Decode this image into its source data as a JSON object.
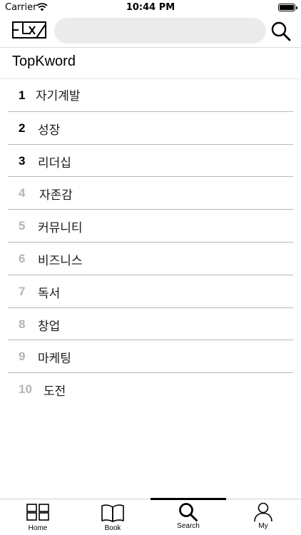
{
  "status_bar": {
    "carrier": "Carrier",
    "time": "10:44 PM",
    "icons": [
      "wifi-icon",
      "battery-icon"
    ]
  },
  "header": {
    "logo_icon": "brand-logo-icon",
    "search_placeholder": "",
    "search_icon": "search-icon"
  },
  "section": {
    "title": "TopKword"
  },
  "rankings": [
    {
      "rank": "1",
      "word": "자기계발"
    },
    {
      "rank": "2",
      "word": "성장"
    },
    {
      "rank": "3",
      "word": "리더십"
    },
    {
      "rank": "4",
      "word": "자존감"
    },
    {
      "rank": "5",
      "word": "커뮤니티"
    },
    {
      "rank": "6",
      "word": "비즈니스"
    },
    {
      "rank": "7",
      "word": "독서"
    },
    {
      "rank": "8",
      "word": "창업"
    },
    {
      "rank": "9",
      "word": "마케팅"
    },
    {
      "rank": "10",
      "word": "도전"
    }
  ],
  "colors": {
    "top_rank": "#000000",
    "other_rank": "#b5b5b5",
    "search_background": "#ebebeb"
  },
  "tab_bar": {
    "active_tab": "Search",
    "tabs": [
      {
        "label": "Home",
        "icon": "grid-icon"
      },
      {
        "label": "Book",
        "icon": "book-icon"
      },
      {
        "label": "Search",
        "icon": "search-icon"
      },
      {
        "label": "My",
        "icon": "user-icon"
      }
    ]
  }
}
